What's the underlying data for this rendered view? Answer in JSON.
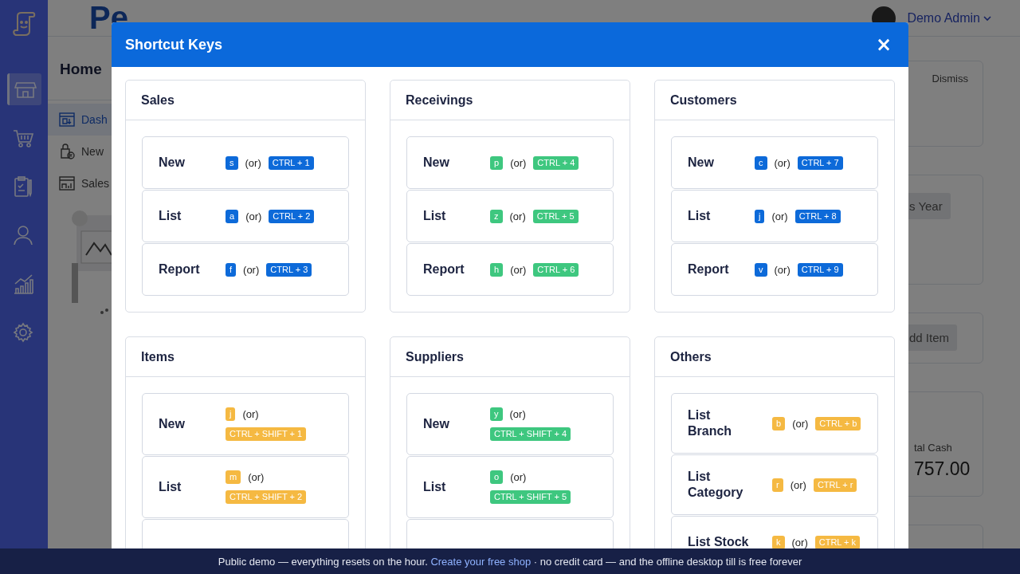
{
  "sidebar": {
    "items": [
      {
        "selected": true
      },
      {
        "selected": false
      },
      {
        "selected": false
      },
      {
        "selected": false
      },
      {
        "selected": false
      },
      {
        "selected": false
      }
    ]
  },
  "header": {
    "logo": "Pe",
    "user": "Demo Admin"
  },
  "nav": {
    "title": "Home",
    "items": [
      {
        "label": "Dash",
        "selected": true
      },
      {
        "label": "New",
        "selected": false
      },
      {
        "label": "Sales",
        "selected": false
      }
    ]
  },
  "right_panels": [
    {
      "kind": "notice",
      "text": "Dismiss"
    },
    {
      "kind": "button",
      "text": "s Year"
    },
    {
      "kind": "button",
      "text": "dd Item"
    },
    {
      "kind": "stat",
      "label": "tal Cash",
      "value": "757.00"
    },
    {
      "kind": "empty"
    }
  ],
  "modal": {
    "title": "Shortcut Keys",
    "close": "×",
    "groups": [
      {
        "title": "Sales",
        "color": "#0d6ad9",
        "shortcuts": [
          {
            "action": "New",
            "key": "s",
            "or": "(or)",
            "combo": "CTRL + 1"
          },
          {
            "action": "List",
            "key": "a",
            "or": "(or)",
            "combo": "CTRL + 2"
          },
          {
            "action": "Report",
            "key": "f",
            "or": "(or)",
            "combo": "CTRL + 3"
          }
        ]
      },
      {
        "title": "Receivings",
        "color": "#3ec77f",
        "shortcuts": [
          {
            "action": "New",
            "key": "p",
            "or": "(or)",
            "combo": "CTRL + 4"
          },
          {
            "action": "List",
            "key": "z",
            "or": "(or)",
            "combo": "CTRL + 5"
          },
          {
            "action": "Report",
            "key": "h",
            "or": "(or)",
            "combo": "CTRL + 6"
          }
        ]
      },
      {
        "title": "Customers",
        "color": "#0d6ad9",
        "shortcuts": [
          {
            "action": "New",
            "key": "c",
            "or": "(or)",
            "combo": "CTRL + 7"
          },
          {
            "action": "List",
            "key": "j",
            "or": "(or)",
            "combo": "CTRL + 8"
          },
          {
            "action": "Report",
            "key": "v",
            "or": "(or)",
            "combo": "CTRL + 9"
          }
        ]
      },
      {
        "title": "Items",
        "color": "#f5b942",
        "shortcuts": [
          {
            "action": "New",
            "key": "j",
            "or": "(or)",
            "combo": "CTRL + SHIFT + 1"
          },
          {
            "action": "List",
            "key": "m",
            "or": "(or)",
            "combo": "CTRL + SHIFT + 2"
          },
          {
            "kind": "cut"
          }
        ]
      },
      {
        "title": "Suppliers",
        "color": "#3ec77f",
        "shortcuts": [
          {
            "action": "New",
            "key": "y",
            "or": "(or)",
            "combo": "CTRL + SHIFT + 4"
          },
          {
            "action": "List",
            "key": "o",
            "or": "(or)",
            "combo": "CTRL + SHIFT + 5"
          },
          {
            "kind": "cut"
          }
        ]
      },
      {
        "title": "Others",
        "color": "#f5b942",
        "shortcuts": [
          {
            "action": "List Branch",
            "key": "b",
            "or": "(or)",
            "combo": "CTRL + b"
          },
          {
            "action": "List Category",
            "key": "r",
            "or": "(or)",
            "combo": "CTRL + r"
          },
          {
            "action": "List Stock",
            "key": "k",
            "or": "(or)",
            "combo": "CTRL + k"
          }
        ]
      }
    ]
  },
  "footer": {
    "text_before": "Public demo — everything resets on the hour.",
    "link": "Create your free shop",
    "text_after": "· no credit card — and the offline desktop till is free forever"
  }
}
